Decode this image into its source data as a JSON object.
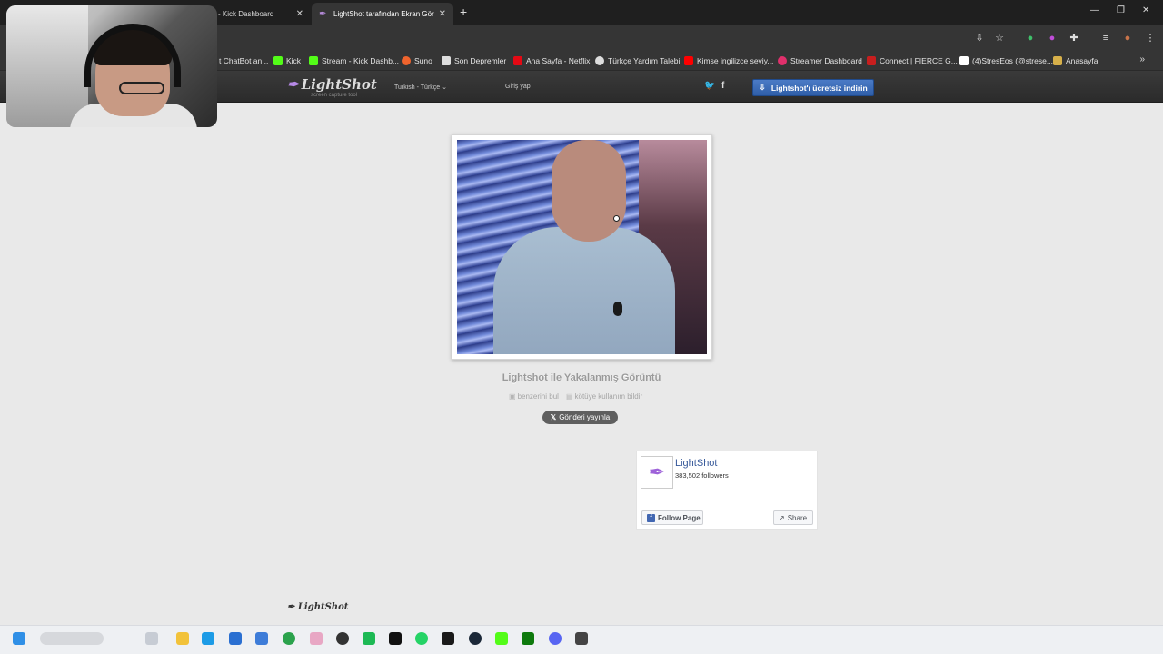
{
  "browser": {
    "tabs": [
      {
        "label": "- Kick Dashboard",
        "active": false
      },
      {
        "label": "LightShot tarafından Ekran Gör",
        "active": true
      }
    ],
    "bookmarks": [
      {
        "label": "t ChatBot an...",
        "color": "#5b5b5b"
      },
      {
        "label": "Kick",
        "color": "#53fc18"
      },
      {
        "label": "Stream - Kick Dashb...",
        "color": "#53fc18"
      },
      {
        "label": "Suno",
        "color": "#f0642d"
      },
      {
        "label": "Son Depremler",
        "color": "#dddddd"
      },
      {
        "label": "Ana Sayfa - Netflix",
        "color": "#e50914"
      },
      {
        "label": "Türkçe Yardım Talebi",
        "color": "#dddddd"
      },
      {
        "label": "Kimse ingilizce seviy...",
        "color": "#ff0000"
      },
      {
        "label": "Streamer Dashboard",
        "color": "#e1306c"
      },
      {
        "label": "Connect | FIERCE G...",
        "color": "#c81e1e"
      },
      {
        "label": "(4)StresEos (@strese...",
        "color": "#ffffff"
      },
      {
        "label": "Anasayfa",
        "color": "#d7b04a"
      }
    ]
  },
  "lightshot": {
    "logo": "LightShot",
    "logo_sub": "screen capture tool",
    "language": "Turkish - Türkçe",
    "login": "Giriş yap",
    "download_button": "Lightshot'ı ücretsiz indirin",
    "caption": "Lightshot ile Yakalanmış Görüntü",
    "find_similar": "benzerini bul",
    "report": "kötüye kullanım bildir",
    "post_button": "Gönderi yayınla",
    "facebook": {
      "page_name": "LightShot",
      "followers": "383,502 followers",
      "follow": "Follow Page",
      "share": "Share"
    },
    "footer": {
      "logo": "LightShot"
    }
  },
  "colors": {
    "accent": "#3a66b0",
    "facebook": "#4267b2"
  }
}
